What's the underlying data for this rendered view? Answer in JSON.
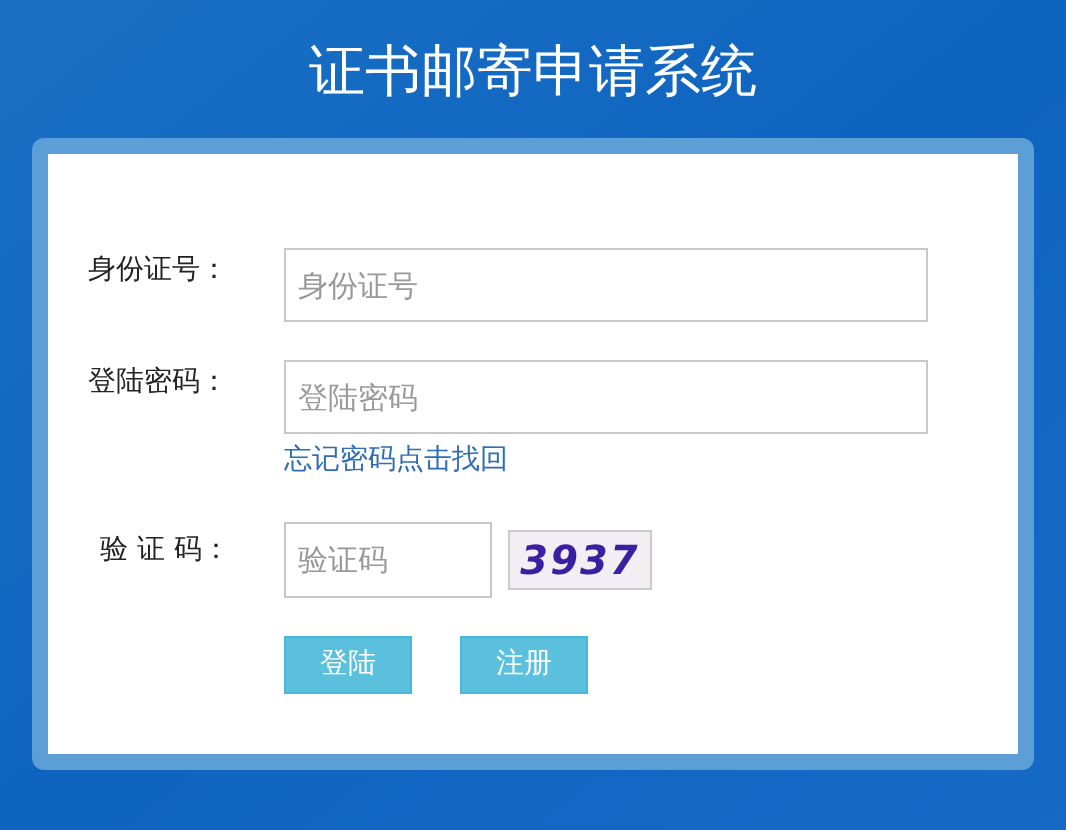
{
  "title": "证书邮寄申请系统",
  "form": {
    "fields": [
      {
        "label": "身份证号：",
        "placeholder": "身份证号"
      },
      {
        "label": "登陆密码：",
        "placeholder": "登陆密码"
      }
    ],
    "forgot_link": "忘记密码点击找回",
    "captcha": {
      "label": "验 证 码：",
      "placeholder": "验证码",
      "code": "3937"
    },
    "buttons": [
      "登陆",
      "注册"
    ]
  }
}
